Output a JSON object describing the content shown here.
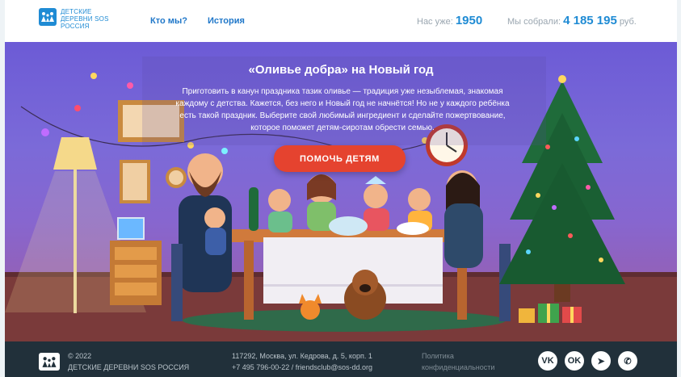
{
  "header": {
    "logo_lines": [
      "ДЕТСКИЕ",
      "ДЕРЕВНИ SOS",
      "РОССИЯ"
    ],
    "nav": [
      "Кто мы?",
      "История"
    ],
    "count_label": "Нас уже:",
    "count_value": "1950",
    "raised_label": "Мы собрали:",
    "raised_value": "4 185 195",
    "raised_unit": "руб."
  },
  "hero": {
    "title": "«Оливье добра» на Новый год",
    "text_lines": [
      "Приготовить в канун праздника тазик оливье — традиция уже незыблемая, знакомая",
      "каждому с детства. Кажется, без него и Новый год не начнётся! Но не у каждого ребёнка",
      "есть такой праздник. Выберите свой любимый ингредиент и сделайте пожертвование,",
      "которое поможет детям-сиротам обрести семью."
    ],
    "cta": "ПОМОЧЬ ДЕТЯМ"
  },
  "footer": {
    "copyright": "© 2022",
    "org": "ДЕТСКИЕ ДЕРЕВНИ SOS РОССИЯ",
    "address": "117292, Москва, ул. Кедрова, д. 5, корп. 1",
    "contacts": "+7 495 796-00-22 / friendsclub@sos-dd.org",
    "privacy_lines": [
      "Политика",
      "конфиденциальности"
    ],
    "social": [
      {
        "icon": "vk-icon",
        "glyph": "VK"
      },
      {
        "icon": "odnoklassniki-icon",
        "glyph": "OK"
      },
      {
        "icon": "telegram-icon",
        "glyph": "➤"
      },
      {
        "icon": "whatsapp-icon",
        "glyph": "✆"
      }
    ]
  },
  "colors": {
    "brand": "#1f8bd4",
    "cta": "#e5432f",
    "footer_bg": "#21303a"
  }
}
